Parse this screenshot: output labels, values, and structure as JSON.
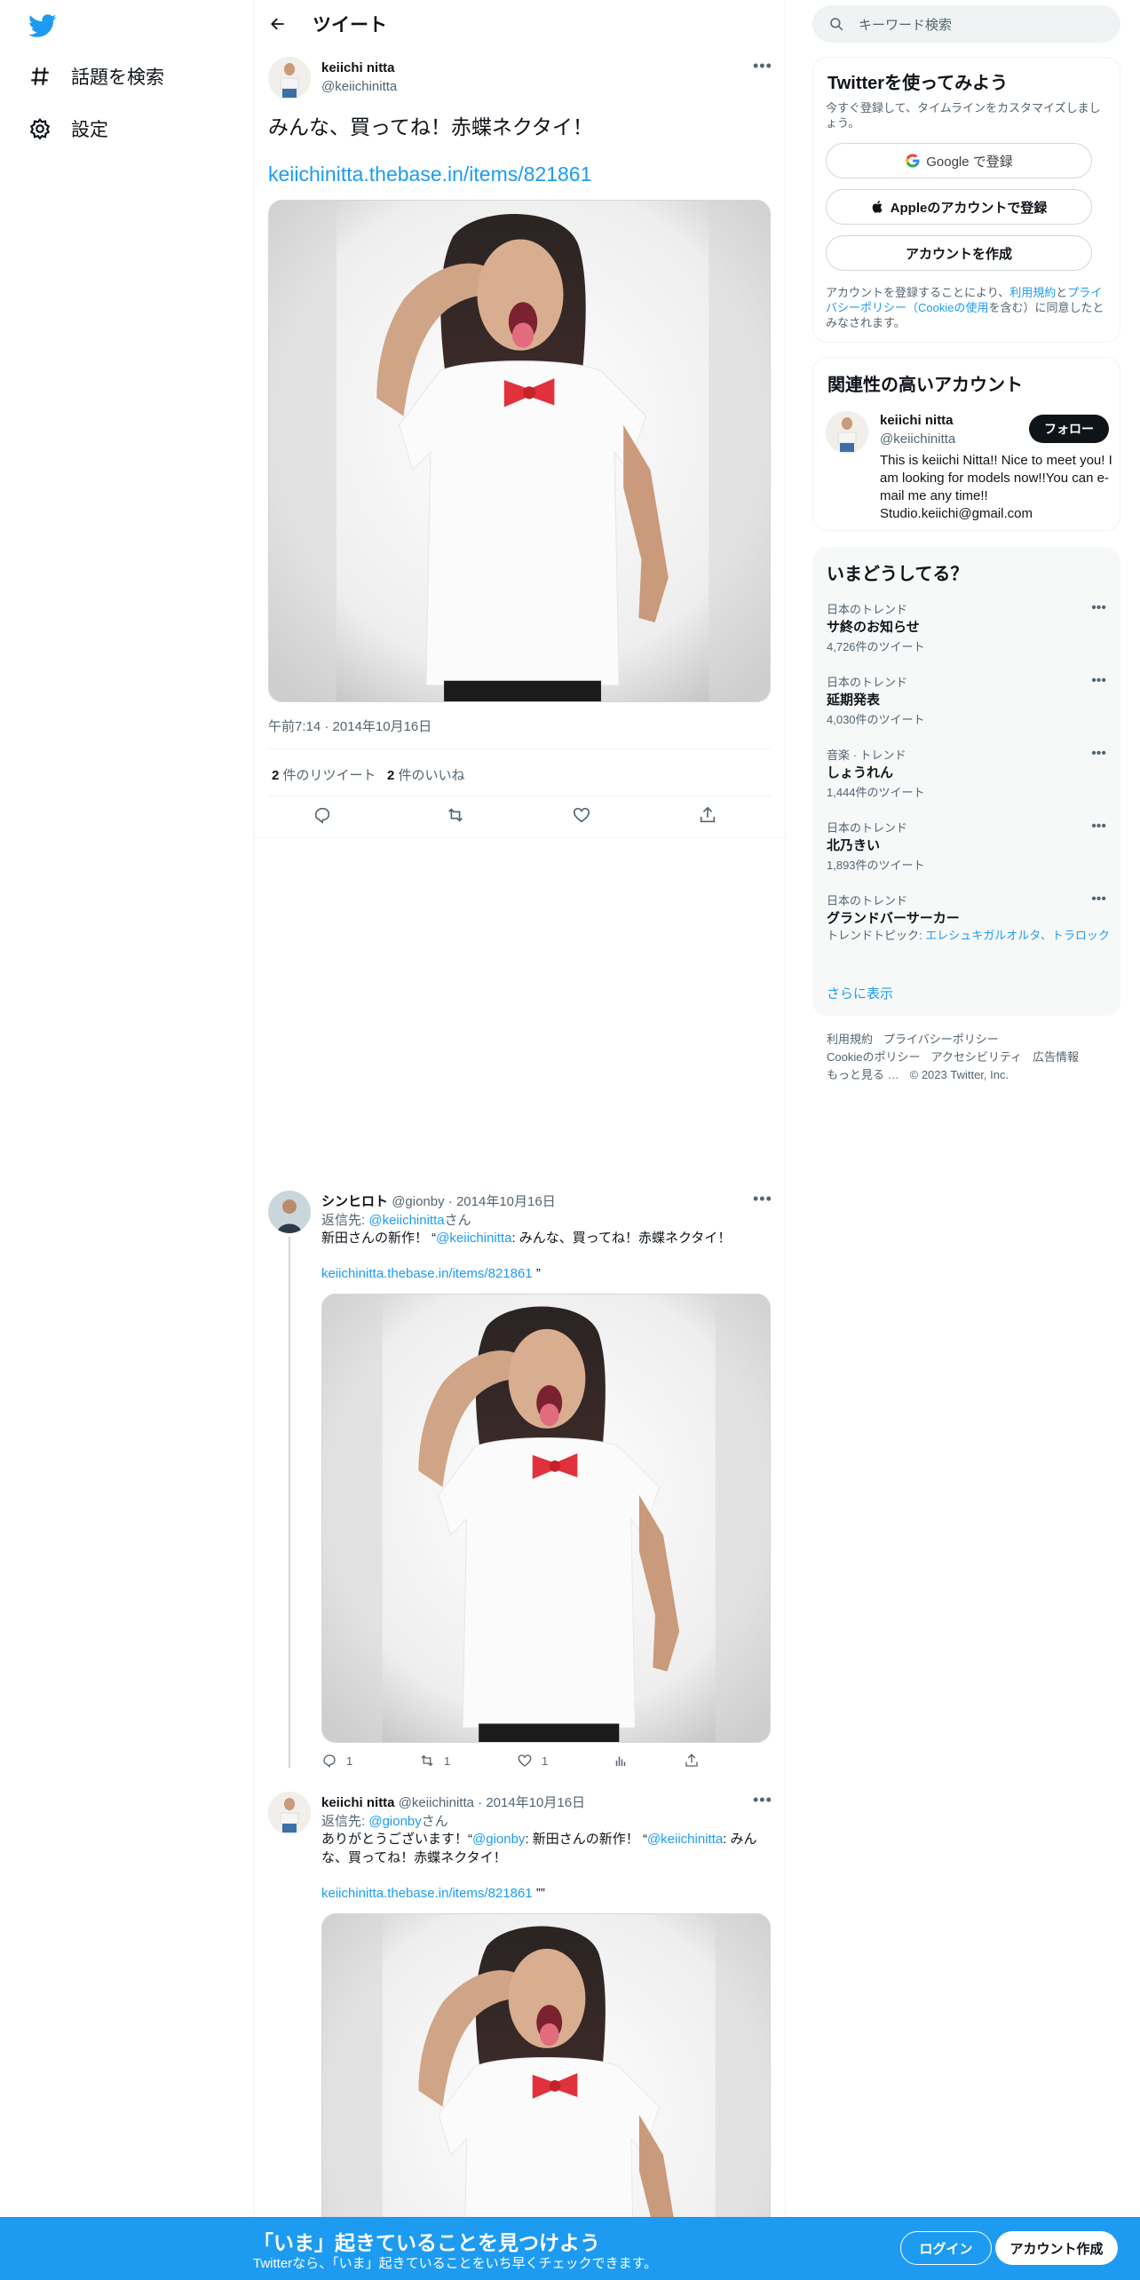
{
  "nav": {
    "logo": "twitter-bird-icon",
    "items": [
      {
        "icon": "hashtag-icon",
        "label": "話題を検索"
      },
      {
        "icon": "gear-icon",
        "label": "設定"
      }
    ]
  },
  "header": {
    "title": "ツイート"
  },
  "tweet": {
    "author_name": "keiichi nitta",
    "author_handle": "@keiichinitta",
    "text": "みんな、買ってね！赤蝶ネクタイ！",
    "link": "keiichinitta.thebase.in/items/821861",
    "timestamp": "午前7:14 · 2014年10月16日",
    "retweets": "2",
    "retweets_label": "件のリツイート",
    "likes": "2",
    "likes_label": "件のいいね"
  },
  "replies": [
    {
      "author_name": "シンヒロト",
      "author_handle": "@gionby",
      "date": "2014年10月16日",
      "reply_to_prefix": "返信先: ",
      "reply_to_handle": "@keiichinitta",
      "reply_to_suffix": "さん",
      "text_line1_a": "新田さんの新作！ “",
      "text_line1_mention": "@keiichinitta",
      "text_line1_b": ": みんな、買ってね！赤蝶ネクタイ！",
      "link": "keiichinitta.thebase.in/items/821861",
      "link_suffix": " ”",
      "reply_count": "1",
      "retweet_count": "1",
      "like_count": "1"
    },
    {
      "author_name": "keiichi nitta",
      "author_handle": "@keiichinitta",
      "date": "2014年10月16日",
      "reply_to_prefix": "返信先: ",
      "reply_to_handle": "@gionby",
      "reply_to_suffix": "さん",
      "text_a": "ありがとうございます！“",
      "text_mention1": "@gionby",
      "text_b": ": 新田さんの新作！ “",
      "text_mention2": "@keiichinitta",
      "text_c": ": みんな、買ってね！赤蝶ネクタイ！",
      "link": "keiichinitta.thebase.in/items/821861",
      "link_suffix": " ””"
    }
  ],
  "search": {
    "placeholder": "キーワード検索"
  },
  "signup_card": {
    "title": "Twitterを使ってみよう",
    "subtitle": "今すぐ登録して、タイムラインをカスタマイズしましょう。",
    "google": "Google で登録",
    "apple": "Appleのアカウントで登録",
    "create": "アカウントを作成",
    "terms_a": "アカウントを登録することにより、",
    "terms_link1": "利用規約",
    "terms_b": "と",
    "terms_link2": "プライバシーポリシー（Cookieの使用",
    "terms_c": "を含む）に同意したとみなされます。"
  },
  "relevant": {
    "title": "関連性の高いアカウント",
    "name": "keiichi nitta",
    "handle": "@keiichinitta",
    "follow": "フォロー",
    "bio": "This is keiichi Nitta!! Nice to meet you! I am looking for models now!!You can e-mail me any time!! Studio.keiichi@gmail.com"
  },
  "trends": {
    "title": "いまどうしてる？",
    "items": [
      {
        "category": "日本のトレンド",
        "name": "サ終のお知らせ",
        "count": "4,726件のツイート"
      },
      {
        "category": "日本のトレンド",
        "name": "延期発表",
        "count": "4,030件のツイート"
      },
      {
        "category": "音楽 · トレンド",
        "name": "しょうれん",
        "count": "1,444件のツイート"
      },
      {
        "category": "日本のトレンド",
        "name": "北乃きい",
        "count": "1,893件のツイート"
      },
      {
        "category": "日本のトレンド",
        "name": "グランドバーサーカー",
        "topic_prefix": "トレンドトピック: ",
        "topic": "エレシュキガルオルタ、トラロック"
      }
    ],
    "show_more": "さらに表示"
  },
  "footer": {
    "links_row1": [
      "利用規約",
      "プライバシーポリシー"
    ],
    "links_row2": [
      "Cookieのポリシー",
      "アクセシビリティ",
      "広告情報"
    ],
    "more": "もっと見る …",
    "copyright": "© 2023 Twitter, Inc."
  },
  "bottom_bar": {
    "headline": "「いま」起きていることを見つけよう",
    "sub": "Twitterなら、「いま」起きていることをいち早くチェックできます。",
    "login": "ログイン",
    "signup": "アカウント作成"
  },
  "colors": {
    "accent": "#1d9bf0",
    "text": "#0f1419",
    "secondary": "#536471",
    "border": "#eff3f4"
  }
}
